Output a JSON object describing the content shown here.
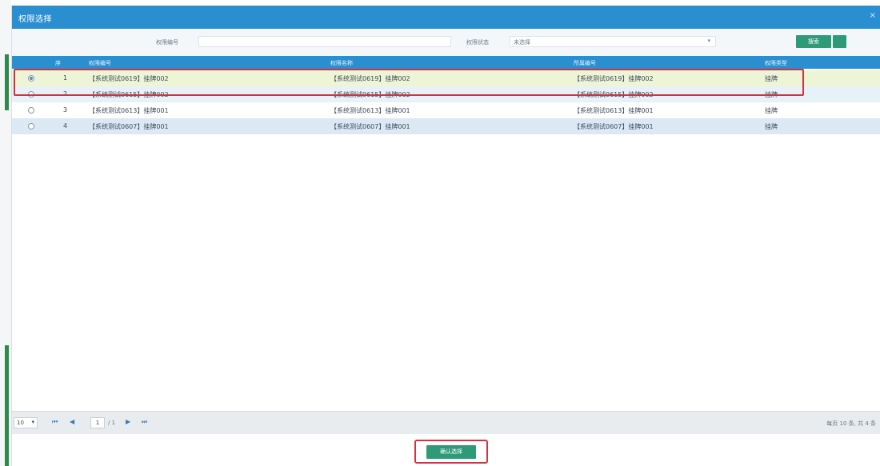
{
  "dialog": {
    "title": "权限选择",
    "close_glyph": "×"
  },
  "search": {
    "field1_label": "权限编号",
    "field1_value": "",
    "field2_label": "权限状态",
    "field2_value": "未选择",
    "search_button": "搜索"
  },
  "table": {
    "headers": [
      "序",
      "权限编号",
      "权限名称",
      "所属编号",
      "权限类型"
    ],
    "rows": [
      {
        "index": "1",
        "selected": true,
        "code": "【系统测试0619】挂牌002",
        "name": "【系统测试0619】挂牌002",
        "parent": "【系统测试0619】挂牌002",
        "type": "挂牌"
      },
      {
        "index": "2",
        "selected": false,
        "code": "【系统测试0615】挂牌002",
        "name": "【系统测试0615】挂牌002",
        "parent": "【系统测试0615】挂牌002",
        "type": "挂牌"
      },
      {
        "index": "3",
        "selected": false,
        "code": "【系统测试0613】挂牌001",
        "name": "【系统测试0613】挂牌001",
        "parent": "【系统测试0613】挂牌001",
        "type": "挂牌"
      },
      {
        "index": "4",
        "selected": false,
        "code": "【系统测试0607】挂牌001",
        "name": "【系统测试0607】挂牌001",
        "parent": "【系统测试0607】挂牌001",
        "type": "挂牌"
      }
    ]
  },
  "pager": {
    "page_size": "10",
    "current_page": "1",
    "total_pages": "/ 1",
    "info": "每页 10 条, 共 4 条",
    "first_icon": "⏮",
    "prev_icon": "◀",
    "next_icon": "▶",
    "last_icon": "⏭"
  },
  "footer": {
    "confirm_button": "确认选择"
  },
  "colors": {
    "header_blue": "#2a8fd0",
    "accent_green": "#2e9a78",
    "highlight_red": "#d3323c",
    "selected_row": "#eef5d6"
  }
}
